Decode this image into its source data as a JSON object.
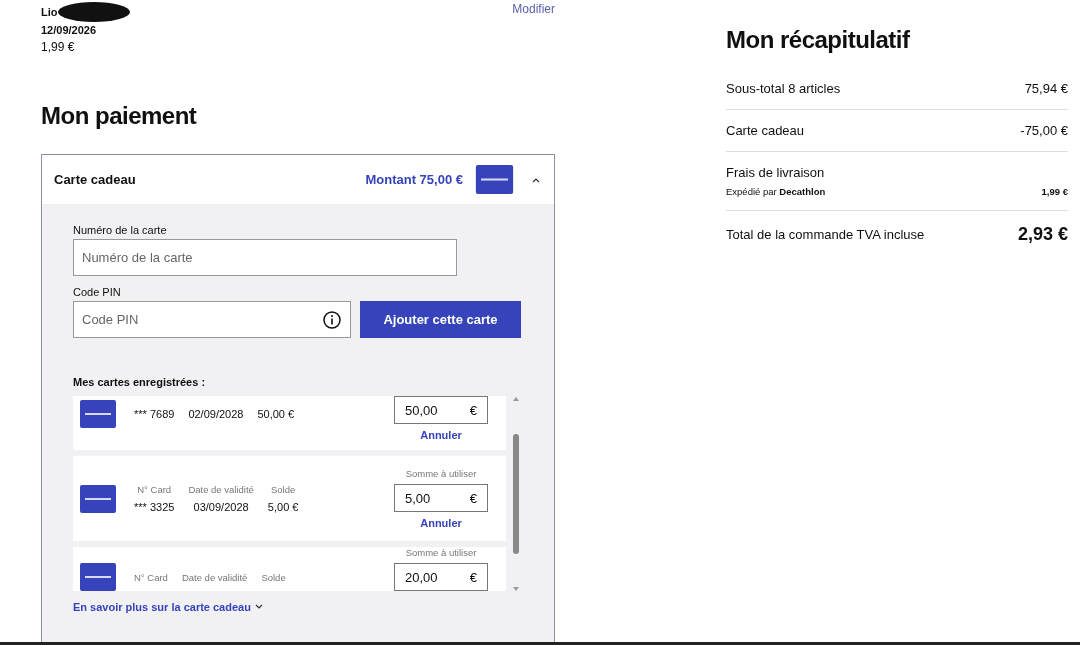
{
  "delivery": {
    "name": "Lio",
    "date": "12/09/2026",
    "price": "1,99 €",
    "edit_link": "Modifier"
  },
  "payment": {
    "title": "Mon paiement",
    "gift_card": {
      "title": "Carte cadeau",
      "amount": "Montant 75,00 €",
      "expanded": true,
      "card_number": {
        "label": "Numéro de la carte",
        "placeholder": "Numéro de la carte"
      },
      "pin": {
        "label": "Code PIN",
        "placeholder": "Code PIN"
      },
      "add_button": "Ajouter cette carte",
      "saved_title": "Mes cartes enregistrées :",
      "saved_cards": [
        {
          "number": "*** 7689",
          "validity": "02/09/2028",
          "balance": "50,00 €",
          "amount": "50,00",
          "currency": "€",
          "cancel": "Annuler"
        },
        {
          "number_label": "N° Card",
          "validity_label": "Date de validité",
          "balance_label": "Solde",
          "number": "*** 3325",
          "validity": "03/09/2028",
          "balance": "5,00 €",
          "amount_label": "Somme à utiliser",
          "amount": "5,00",
          "currency": "€",
          "cancel": "Annuler"
        },
        {
          "number_label": "N° Card",
          "validity_label": "Date de validité",
          "balance_label": "Solde",
          "amount_label": "Somme à utiliser",
          "amount": "20,00",
          "currency": "€"
        }
      ],
      "more_link": {
        "label": "En savoir plus sur la carte cadeau",
        "expanded": false
      }
    }
  },
  "summary": {
    "title": "Mon récapitulatif",
    "rows": [
      {
        "kind": "line",
        "label": "Sous-total 8 articles",
        "value": "75,94 €"
      },
      {
        "kind": "line",
        "label": "Carte cadeau",
        "value": "-75,00 €"
      },
      {
        "kind": "shipping",
        "label": "Frais de livraison",
        "note": "Expédié par **Decathlon**",
        "value": "1,99 €"
      },
      {
        "kind": "total",
        "label": "Total de la commande TVA incluse",
        "value": "2,93 €"
      }
    ]
  }
}
